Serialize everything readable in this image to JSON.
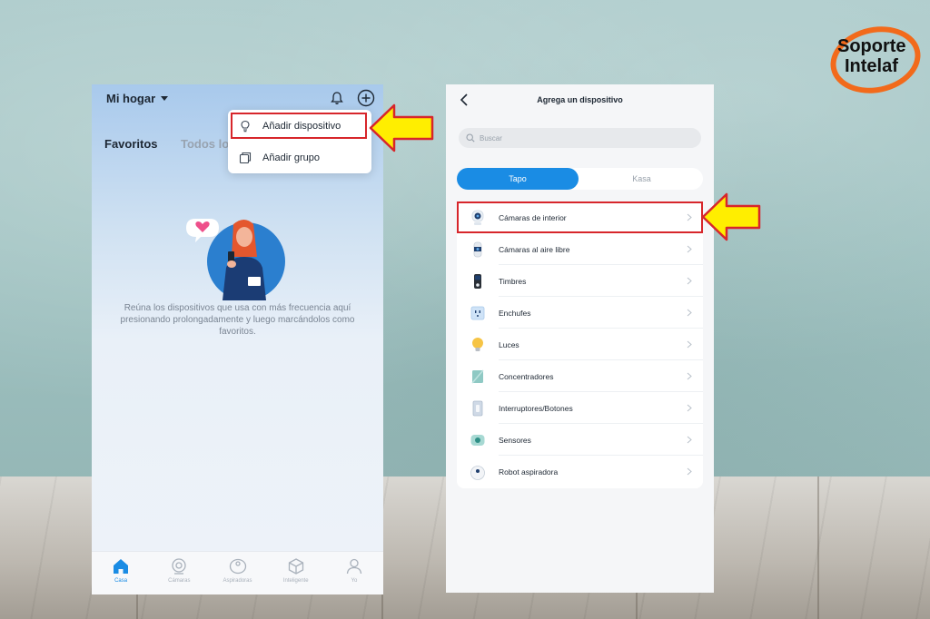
{
  "brand": {
    "line1": "Soporte",
    "line2": "Intelaf",
    "accent_color": "#f26a1b"
  },
  "left_screen": {
    "home_selector": "Mi hogar",
    "header_icons": [
      "bell-icon",
      "plus-circle-icon"
    ],
    "tabs": [
      {
        "label": "Favoritos",
        "active": true
      },
      {
        "label": "Todos lo",
        "active": false
      }
    ],
    "add_menu": {
      "items": [
        {
          "label": "Añadir dispositivo",
          "icon": "lightbulb-outline-icon",
          "highlighted": true
        },
        {
          "label": "Añadir grupo",
          "icon": "group-icon",
          "highlighted": false
        }
      ]
    },
    "empty_message": "Reúna los dispositivos que usa con más frecuencia aquí presionando prolongadamente y luego marcándolos como favoritos.",
    "bottom_nav": [
      {
        "label": "Casa",
        "icon": "home-icon",
        "active": true
      },
      {
        "label": "Cámaras",
        "icon": "camera-icon",
        "active": false
      },
      {
        "label": "Aspiradoras",
        "icon": "vacuum-icon",
        "active": false
      },
      {
        "label": "Inteligente",
        "icon": "cube-icon",
        "active": false
      },
      {
        "label": "Yo",
        "icon": "user-icon",
        "active": false
      }
    ]
  },
  "right_screen": {
    "title": "Agrega un dispositivo",
    "search_placeholder": "Buscar",
    "segments": [
      {
        "label": "Tapo",
        "active": true
      },
      {
        "label": "Kasa",
        "active": false
      }
    ],
    "categories": [
      {
        "label": "Cámaras de interior",
        "icon": "indoor-camera-icon",
        "highlighted": true
      },
      {
        "label": "Cámaras al aire libre",
        "icon": "outdoor-camera-icon",
        "highlighted": false
      },
      {
        "label": "Timbres",
        "icon": "doorbell-icon",
        "highlighted": false
      },
      {
        "label": "Enchufes",
        "icon": "plug-icon",
        "highlighted": false
      },
      {
        "label": "Luces",
        "icon": "bulb-icon",
        "highlighted": false
      },
      {
        "label": "Concentradores",
        "icon": "hub-icon",
        "highlighted": false
      },
      {
        "label": "Interruptores/Botones",
        "icon": "switch-icon",
        "highlighted": false
      },
      {
        "label": "Sensores",
        "icon": "sensor-icon",
        "highlighted": false
      },
      {
        "label": "Robot aspiradora",
        "icon": "robot-vacuum-icon",
        "highlighted": false
      }
    ]
  },
  "colors": {
    "primary": "#1a8ce4",
    "highlight_border": "#d7262b",
    "arrow_fill": "#ffee00"
  }
}
